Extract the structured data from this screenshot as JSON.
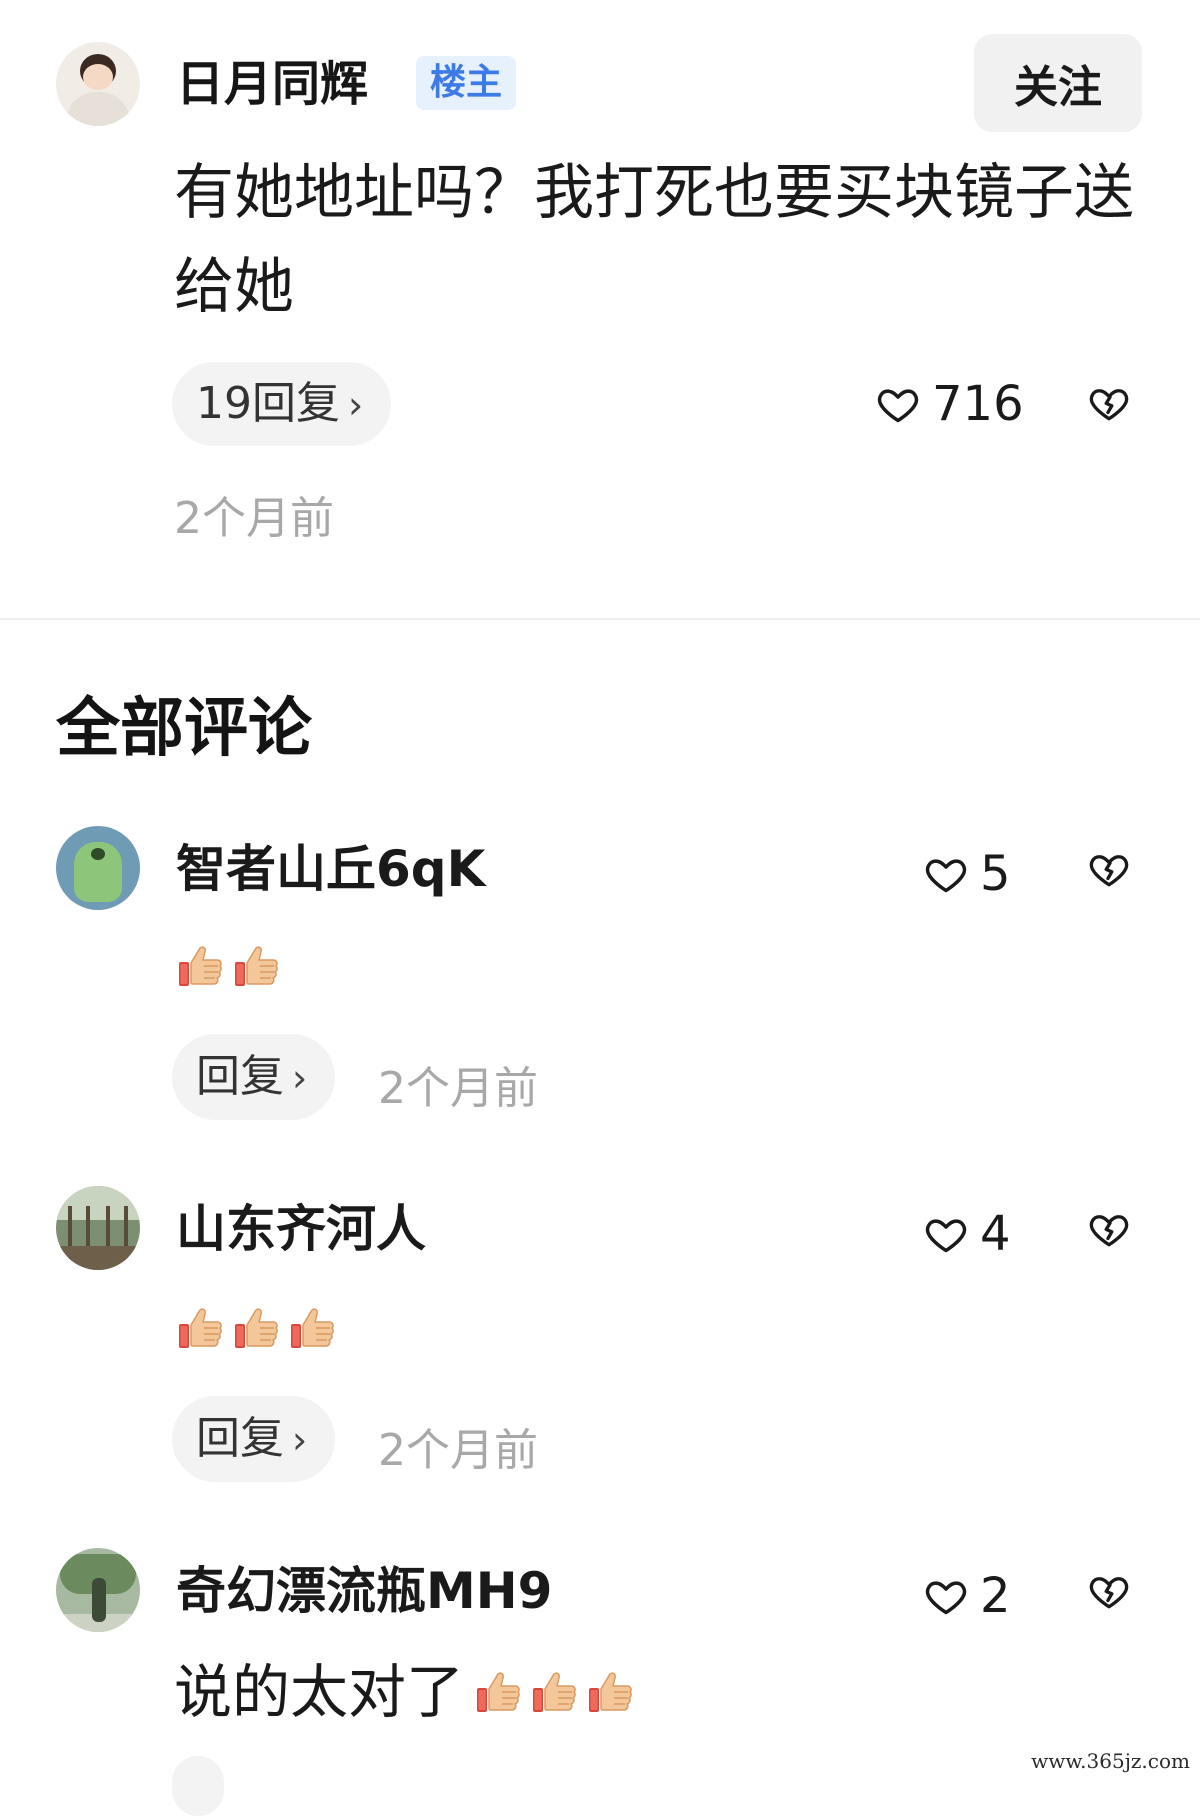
{
  "post": {
    "author": "日月同辉",
    "badge": "楼主",
    "follow_label": "关注",
    "text": "有她地址吗？我打死也要买块镜子送给她",
    "replies_label": "19回复",
    "likes": "716",
    "time": "2个月前"
  },
  "comments_section": {
    "title": "全部评论",
    "comments": [
      {
        "author": "智者山丘6qK",
        "likes": "5",
        "text": "",
        "thumbs": 2,
        "reply_label": "回复",
        "time": "2个月前"
      },
      {
        "author": "山东齐河人",
        "likes": "4",
        "text": "",
        "thumbs": 3,
        "reply_label": "回复",
        "time": "2个月前"
      },
      {
        "author": "奇幻漂流瓶MH9",
        "likes": "2",
        "text": "说的太对了",
        "thumbs": 3
      }
    ]
  },
  "watermark": "www.365jz.com",
  "colors": {
    "badge_bg": "#e7f0fd",
    "badge_text": "#3c7be6",
    "pill_bg": "#f3f3f3",
    "muted_text": "#a8a8a8"
  },
  "icons": {
    "like": "heart-outline-icon",
    "dislike": "broken-heart-icon",
    "thumb": "thumbs-up-emoji",
    "more": "chevron-right-icon"
  }
}
